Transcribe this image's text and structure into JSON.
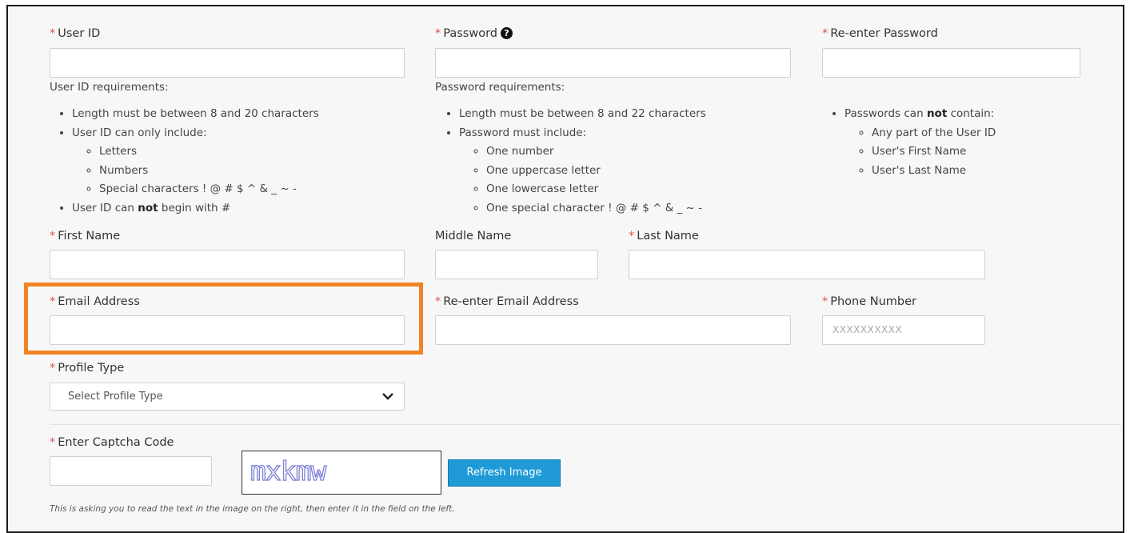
{
  "fields": {
    "user_id": {
      "label": "User ID",
      "value": ""
    },
    "password": {
      "label": "Password",
      "value": ""
    },
    "reenter_password": {
      "label": "Re-enter Password",
      "value": ""
    },
    "first_name": {
      "label": "First Name",
      "value": ""
    },
    "middle_name": {
      "label": "Middle Name",
      "value": ""
    },
    "last_name": {
      "label": "Last Name",
      "value": ""
    },
    "email": {
      "label": "Email Address",
      "value": ""
    },
    "reenter_email": {
      "label": "Re-enter Email Address",
      "value": ""
    },
    "phone": {
      "label": "Phone Number",
      "placeholder": "XXXXXXXXXX",
      "value": ""
    },
    "profile_type": {
      "label": "Profile Type",
      "selected": "Select Profile Type"
    },
    "captcha": {
      "label": "Enter Captcha Code",
      "value": "",
      "image_text": "mxkmw",
      "refresh_label": "Refresh Image"
    }
  },
  "required_marker": "*",
  "user_id_requirements": {
    "heading": "User ID requirements:",
    "item1": "Length must be between 8 and 20 characters",
    "item2": "User ID can only include:",
    "sub": [
      "Letters",
      "Numbers",
      "Special characters ! @ # $ ^ & _ ~ -"
    ],
    "item3_pre": "User ID can ",
    "item3_bold": "not",
    "item3_post": " begin with #"
  },
  "password_requirements": {
    "heading": "Password requirements:",
    "item1": "Length must be between 8 and 22 characters",
    "item2": "Password must include:",
    "sub": [
      "One number",
      "One uppercase letter",
      "One lowercase letter",
      "One special character ! @ # $ ^ & _ ~ -"
    ]
  },
  "password_restrictions": {
    "item_pre": "Passwords can ",
    "item_bold": "not",
    "item_post": " contain:",
    "sub": [
      "Any part of the User ID",
      "User's First Name",
      "User's Last Name"
    ]
  },
  "help_icon": "question-circle-icon",
  "captcha_hint": "This is asking you to read the text in the image on the right, then enter it in the field on the left.",
  "colors": {
    "required": "#d9534f",
    "highlight": "#f08424",
    "button": "#1f9ad6",
    "captcha_text": "#7b7fd6"
  }
}
